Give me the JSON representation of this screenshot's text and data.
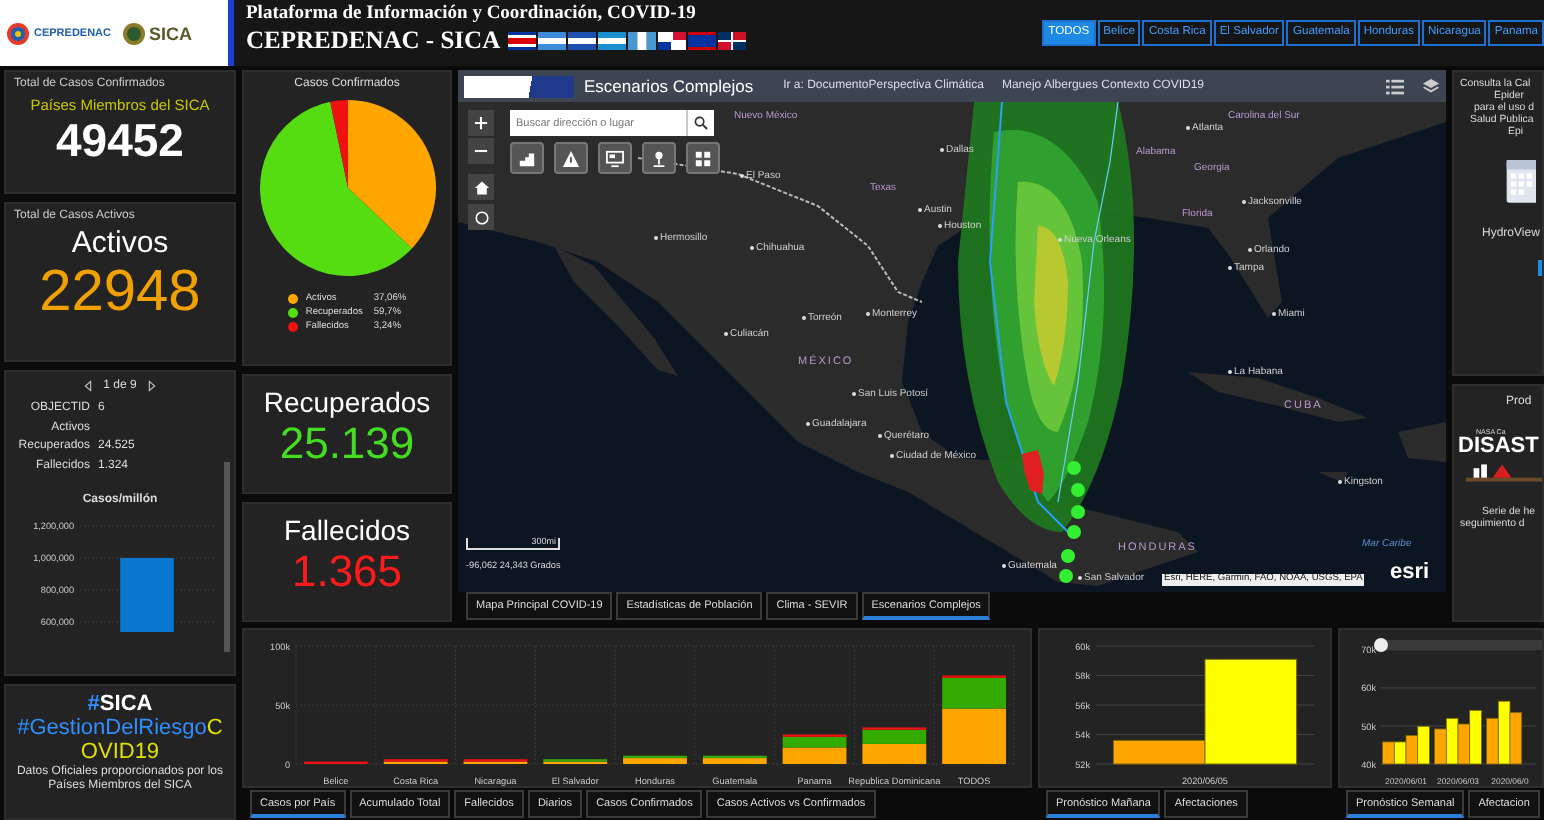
{
  "header": {
    "logos": [
      {
        "text": "CEPREDENAC"
      },
      {
        "text": "SICA"
      }
    ],
    "title": "Plataforma de Información y Coordinación, COVID-19",
    "subtitle": "CEPREDENAC - SICA"
  },
  "country_tabs": [
    {
      "label": "TODOS",
      "selected": true
    },
    {
      "label": "Belice",
      "selected": false
    },
    {
      "label": "Costa Rica",
      "selected": false
    },
    {
      "label": "El Salvador",
      "selected": false
    },
    {
      "label": "Guatemala",
      "selected": false
    },
    {
      "label": "Honduras",
      "selected": false
    },
    {
      "label": "Nicaragua",
      "selected": false
    },
    {
      "label": "Panama",
      "selected": false
    }
  ],
  "confirmed_card": {
    "title": "Total de Casos Confirmados",
    "subtitle": "Países Miembros del SICA",
    "value": "49452"
  },
  "active_card": {
    "title": "Total de Casos Activos",
    "label": "Activos",
    "value": "22948"
  },
  "detail_card": {
    "pager": "1 de 9",
    "fields": [
      {
        "label": "OBJECTID",
        "value": "6"
      },
      {
        "label": "Activos"
      },
      {
        "label": "Recuperados",
        "value": "24.525"
      },
      {
        "label": "Fallecidos",
        "value": "1.324"
      }
    ],
    "chart_title": "Casos/millón",
    "chart_data": {
      "type": "bar",
      "grid": true,
      "series": [
        {
          "color": "#0a78d0",
          "values": [
            1000000
          ]
        }
      ],
      "ylim": [
        537500,
        1200000
      ],
      "yticks": [
        {
          "value": 600000,
          "label": "600,000"
        },
        {
          "value": 800000,
          "label": "800,000"
        },
        {
          "value": 1000000,
          "label": "1,000,000"
        },
        {
          "value": 1200000,
          "label": "1,200,000"
        }
      ]
    }
  },
  "hashtag_card": {
    "lines": [
      {
        "parts": [
          {
            "text": "#",
            "color": "#2f8fff"
          },
          {
            "text": "SICA",
            "color": "#ffffff"
          }
        ]
      },
      {
        "parts": [
          {
            "text": "#GestionDelRiesgo",
            "color": "#2f8fff"
          },
          {
            "text": "COVID19",
            "color": "#e0e000"
          }
        ]
      }
    ],
    "note": "Datos Oficiales proporcionados por los Países Miembros del SICA"
  },
  "pie_card": {
    "title": "Casos Confirmados",
    "chart_data": {
      "type": "pie",
      "categories": [
        "Activos",
        "Recuperados",
        "Fallecidos"
      ],
      "values": [
        37.06,
        59.7,
        3.24
      ]
    },
    "legend": [
      {
        "value": "37,06%",
        "color": "#ffa500"
      },
      {
        "value": "59,7%",
        "color": "#55dd11"
      },
      {
        "value": "3,24%",
        "color": "#ee1111"
      }
    ]
  },
  "recovered_card": {
    "label": "Recuperados",
    "value": "25.139"
  },
  "deaths_card": {
    "label": "Fallecidos",
    "value": "1.365"
  },
  "map": {
    "title": "Escenarios Complejos",
    "links": [
      "Ir a: DocumentoPerspectiva Climática",
      "Manejo Albergues Contexto COVID19"
    ],
    "search": {
      "placeholder": "Buscar dirección o lugar"
    },
    "labels": [
      {
        "text": "Nuevo México",
        "kind": "region"
      },
      {
        "text": "Dallas",
        "kind": "city"
      },
      {
        "text": "El Paso",
        "kind": "city"
      },
      {
        "text": "Texas",
        "kind": "region"
      },
      {
        "text": "Austin",
        "kind": "city"
      },
      {
        "text": "Houston",
        "kind": "city"
      },
      {
        "text": "Hermosillo",
        "kind": "city"
      },
      {
        "text": "Chihuahua",
        "kind": "city"
      },
      {
        "text": "Torreón",
        "kind": "city"
      },
      {
        "text": "Monterrey",
        "kind": "city"
      },
      {
        "text": "Culiacán",
        "kind": "city"
      },
      {
        "text": "MÉXICO",
        "kind": "country"
      },
      {
        "text": "San Luis Potosí",
        "kind": "city"
      },
      {
        "text": "Guadalajara",
        "kind": "city"
      },
      {
        "text": "Querétaro",
        "kind": "city"
      },
      {
        "text": "Ciudad de México",
        "kind": "city"
      },
      {
        "text": "Atlanta",
        "kind": "city"
      },
      {
        "text": "Carolina del Sur",
        "kind": "region"
      },
      {
        "text": "Alabama",
        "kind": "region"
      },
      {
        "text": "Georgia",
        "kind": "region"
      },
      {
        "text": "Nueva Orleans",
        "kind": "city"
      },
      {
        "text": "Florida",
        "kind": "region"
      },
      {
        "text": "Jacksonville",
        "kind": "city"
      },
      {
        "text": "Orlando",
        "kind": "city"
      },
      {
        "text": "Tampa",
        "kind": "city"
      },
      {
        "text": "Miami",
        "kind": "city"
      },
      {
        "text": "La Habana",
        "kind": "city"
      },
      {
        "text": "CUBA",
        "kind": "country"
      },
      {
        "text": "Kingston",
        "kind": "city"
      },
      {
        "text": "Mar Caribe",
        "kind": "water"
      },
      {
        "text": "Guatemala",
        "kind": "city"
      },
      {
        "text": "HONDURAS",
        "kind": "country"
      },
      {
        "text": "San Salvador",
        "kind": "city"
      }
    ],
    "scale": "300mi",
    "coordinates": "-96,062 24,343 Grados",
    "attribution": "Esri, HERE, Garmin, FAO, NOAA, USGS, EPA",
    "brand": "esri",
    "tabs": [
      {
        "label": "Mapa Principal COVID-19",
        "selected": false
      },
      {
        "label": "Estadísticas de Población",
        "selected": false
      },
      {
        "label": "Clima - SEVIR",
        "selected": false
      },
      {
        "label": "Escenarios Complejos",
        "selected": true
      }
    ]
  },
  "right_panels": {
    "calendar": {
      "lines": [
        "Consulta la Cal",
        "Epider",
        "para el uso d",
        "Salud Publica",
        "Epi"
      ],
      "caption": "HydroView"
    },
    "products": {
      "title": "Prod",
      "small_text": "NASA Ca",
      "logo": "DISAST",
      "lines": [
        "Serie de he",
        "seguimiento d"
      ]
    }
  },
  "cases_chart": {
    "chart_data": {
      "type": "bar",
      "stacked": true,
      "grid": true,
      "categories": [
        "Belice",
        "Costa Rica",
        "Nicaragua",
        "El Salvador",
        "Honduras",
        "Guatemala",
        "Panama",
        "Republica Dominicana",
        "TODOS"
      ],
      "series": [
        {
          "color": "#ffa500",
          "values": [
            null,
            1000,
            1000,
            2000,
            5000,
            5000,
            14000,
            17000,
            47000
          ]
        },
        {
          "color": "#33aa00",
          "values": [
            null,
            null,
            null,
            2000,
            2000,
            2000,
            9000,
            12000,
            26000
          ]
        },
        {
          "color": "#ee1111",
          "values": [
            1000,
            1000,
            1000,
            null,
            null,
            null,
            1000,
            1000,
            2000
          ]
        }
      ],
      "ylim": [
        0,
        100000
      ],
      "yticks": [
        {
          "value": 0,
          "label": "0"
        },
        {
          "value": 50000,
          "label": "50k"
        },
        {
          "value": 100000,
          "label": "100k"
        }
      ]
    },
    "tabs": [
      {
        "label": "Casos por País",
        "selected": true
      },
      {
        "label": "Acumulado Total",
        "selected": false
      },
      {
        "label": "Fallecidos",
        "selected": false
      },
      {
        "label": "Diarios",
        "selected": false
      },
      {
        "label": "Casos Confirmados",
        "selected": false
      },
      {
        "label": "Casos Activos vs Confirmados",
        "selected": false
      }
    ]
  },
  "forecast_day": {
    "chart_data": {
      "type": "bar",
      "grid": true,
      "categories": [
        "2020/06/05"
      ],
      "series": [
        {
          "color": "#ffa500",
          "values": [
            53600
          ]
        },
        {
          "color": "#ffff00",
          "values": [
            59100
          ]
        }
      ],
      "ylim": [
        52000,
        60000
      ],
      "yticks": [
        {
          "value": 52000,
          "label": "52k"
        },
        {
          "value": 54000,
          "label": "54k"
        },
        {
          "value": 56000,
          "label": "56k"
        },
        {
          "value": 58000,
          "label": "58k"
        },
        {
          "value": 60000,
          "label": "60k"
        }
      ]
    },
    "tabs": [
      {
        "label": "Pronóstico Mañana",
        "selected": true
      },
      {
        "label": "Afectaciones",
        "selected": false
      }
    ]
  },
  "forecast_week": {
    "zoom_slider": {
      "level": 0
    },
    "chart_data": {
      "type": "bar",
      "grid": true,
      "categories": [
        "2020/06/01",
        "2020/06/03",
        "2020/06/0"
      ],
      "series": [
        {
          "color": "#ffa500",
          "values": [
            45800,
            49200,
            52000
          ]
        },
        {
          "color": "#ffff00",
          "values": [
            45800,
            52000,
            56500
          ]
        },
        {
          "color": "#ffa500",
          "values": [
            47500,
            50500,
            53500
          ]
        },
        {
          "color": "#ffff00",
          "values": [
            49900,
            54100,
            null
          ]
        }
      ],
      "ylim": [
        40000,
        71000
      ],
      "yticks": [
        {
          "value": 40000,
          "label": "40k"
        },
        {
          "value": 50000,
          "label": "50k"
        },
        {
          "value": 60000,
          "label": "60k"
        },
        {
          "value": 70000,
          "label": "70k"
        }
      ]
    },
    "tabs": [
      {
        "label": "Pronóstico Semanal",
        "selected": true
      },
      {
        "label": "Afectacion",
        "selected": false
      }
    ]
  }
}
